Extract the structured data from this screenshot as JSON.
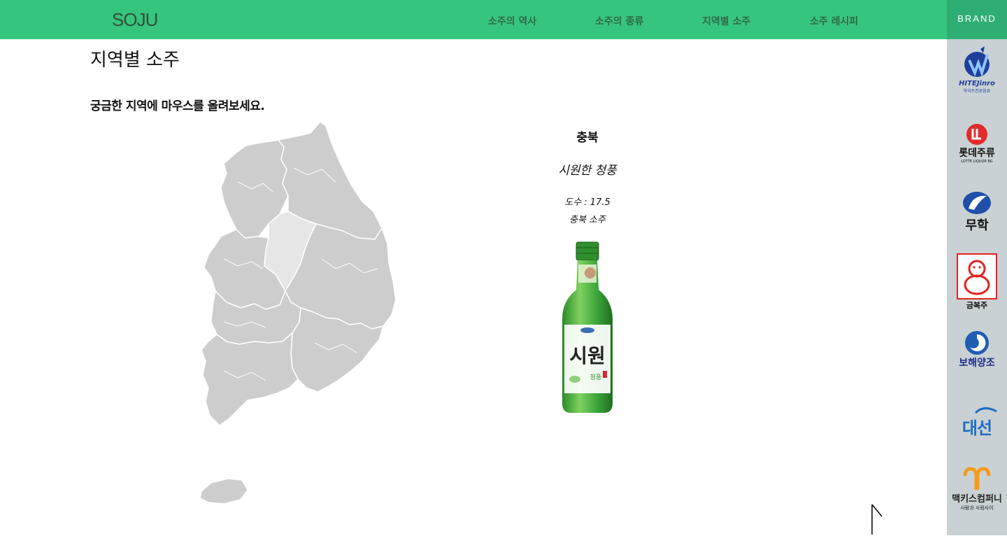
{
  "header": {
    "logo": "SOJU",
    "nav": [
      {
        "label": "소주의 역사"
      },
      {
        "label": "소주의 종류"
      },
      {
        "label": "지역별 소주"
      },
      {
        "label": "소주 레시피"
      }
    ]
  },
  "page": {
    "title": "지역별 소주",
    "instruction": "궁금한 지역에 마우스를 올려보세요."
  },
  "map": {
    "highlighted_region": "충북",
    "base_color": "#cdcdcd",
    "highlight_color": "#e6e6e6"
  },
  "info": {
    "region": "충북",
    "soju_name": "시원한 청풍",
    "abv": "도수 : 17.5",
    "description": "충북 소주",
    "bottle_label": "시원",
    "bottle_sub": "청풍"
  },
  "brand_sidebar": {
    "title": "BRAND",
    "brands": [
      {
        "name": "HITEJinro",
        "sub": "하이트진로음료",
        "icon": "hitejinro-logo"
      },
      {
        "name": "롯데주류",
        "sub": "LOTTE LIQUOR BG",
        "icon": "lotte-liquor-logo"
      },
      {
        "name": "무학",
        "icon": "muhak-logo"
      },
      {
        "name": "금복주",
        "icon": "geumbokju-logo"
      },
      {
        "name": "보해양조",
        "icon": "bohae-logo"
      },
      {
        "name": "대선",
        "icon": "daesun-logo"
      },
      {
        "name": "맥키스컴퍼니",
        "sub": "사람과 사람사이",
        "icon": "mackiss-logo"
      }
    ]
  },
  "colors": {
    "header_green": "#36c57f",
    "brand_header_green": "#2fae73",
    "sidebar_gray": "#c9d1d4"
  }
}
